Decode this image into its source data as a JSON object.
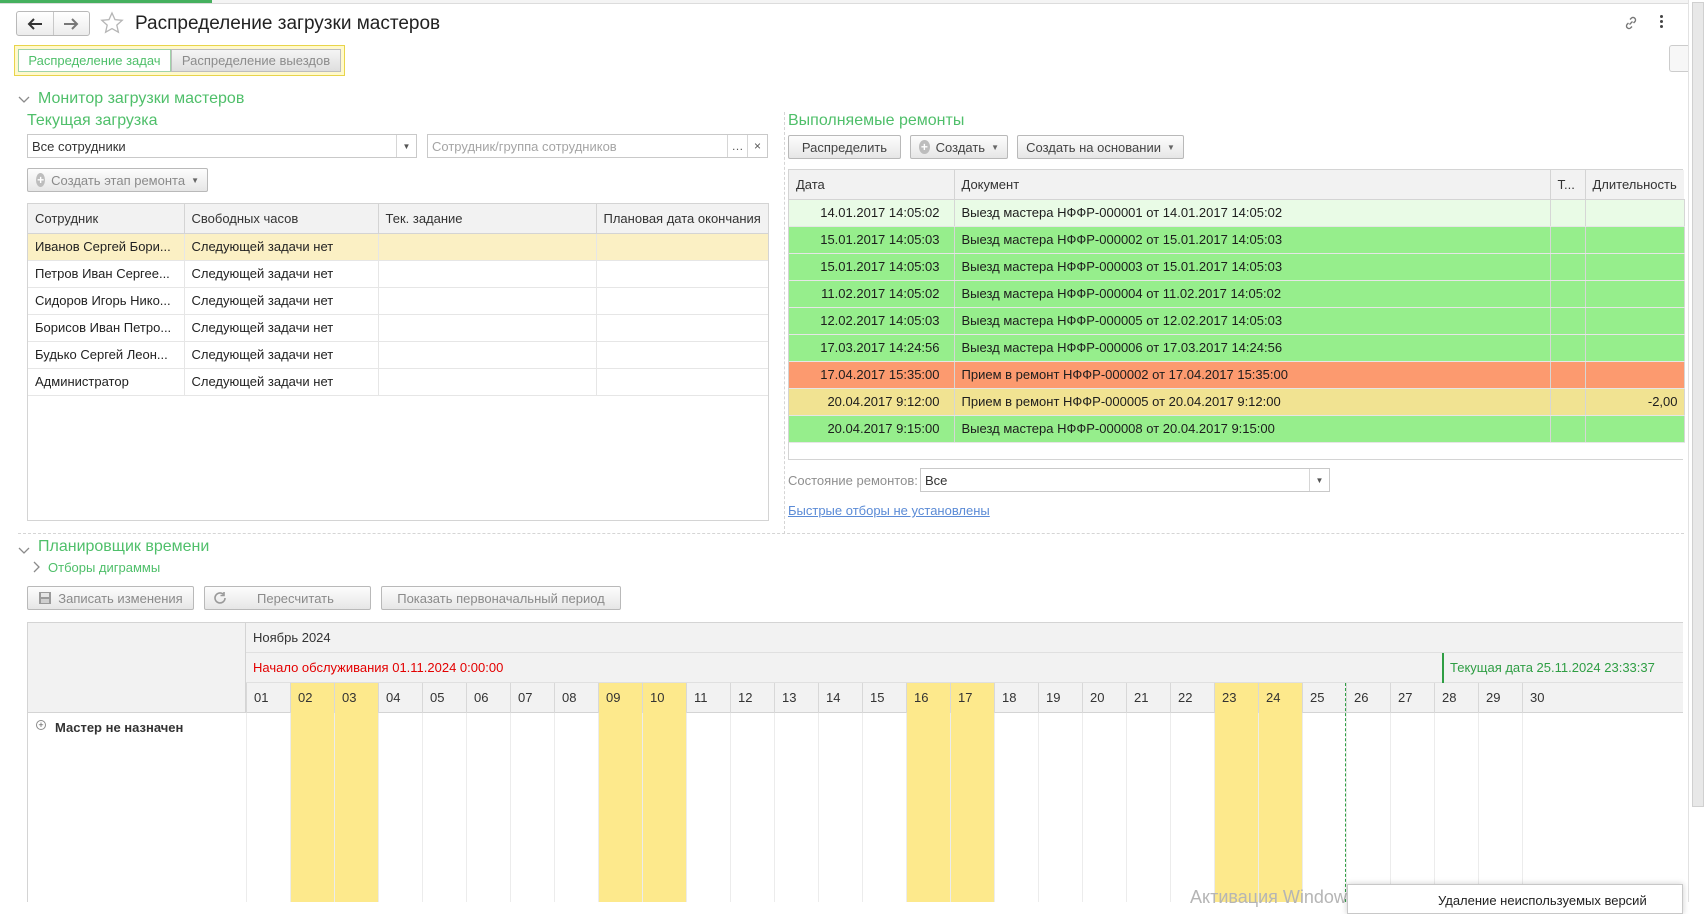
{
  "window": {
    "title": "Распределение загрузки мастеров",
    "tabs": [
      "Распределение задач",
      "Распределение выездов"
    ],
    "active_tab": 0,
    "colors": {
      "accent_green": "#4fbf6a",
      "row_green": "#96ee8c",
      "row_light_green": "#e9fbe6",
      "row_red": "#fc9a6f",
      "row_yellow": "#f1e392",
      "weekend_yellow": "#fde98c",
      "selected_row": "#fbf0c4",
      "start_red": "#e30000"
    }
  },
  "monitor": {
    "section_title": "Монитор загрузки мастеров",
    "current_load": {
      "title": "Текущая загрузка",
      "employee_filter_value": "Все сотрудники",
      "group_filter_placeholder": "Сотрудник/группа сотрудников",
      "create_stage_button": "Создать этап ремонта",
      "columns": [
        "Сотрудник",
        "Свободных часов",
        "Тек. задание",
        "Плановая дата окончания"
      ],
      "rows": [
        {
          "employee": "Иванов Сергей Бори...",
          "free_hours": "Следующей задачи нет",
          "task": "",
          "planned_end": ""
        },
        {
          "employee": "Петров Иван Сергее...",
          "free_hours": "Следующей задачи нет",
          "task": "",
          "planned_end": ""
        },
        {
          "employee": "Сидоров Игорь Нико...",
          "free_hours": "Следующей задачи нет",
          "task": "",
          "planned_end": ""
        },
        {
          "employee": "Борисов Иван Петро...",
          "free_hours": "Следующей задачи нет",
          "task": "",
          "planned_end": ""
        },
        {
          "employee": "Будько Сергей Леон...",
          "free_hours": "Следующей задачи нет",
          "task": "",
          "planned_end": ""
        },
        {
          "employee": "Администратор",
          "free_hours": "Следующей задачи нет",
          "task": "",
          "planned_end": ""
        }
      ]
    },
    "repairs": {
      "title": "Выполняемые ремонты",
      "buttons": {
        "distribute": "Распределить",
        "create": "Создать",
        "create_based_on": "Создать на основании"
      },
      "columns": [
        "Дата",
        "Документ",
        "Т...",
        "Длительность"
      ],
      "rows": [
        {
          "date": "14.01.2017 14:05:02",
          "document": "Выезд мастера НФФР-000001 от 14.01.2017 14:05:02",
          "t": "",
          "duration": "",
          "color": "#e9fbe6"
        },
        {
          "date": "15.01.2017 14:05:03",
          "document": "Выезд мастера НФФР-000002 от 15.01.2017 14:05:03",
          "t": "",
          "duration": "",
          "color": "#96ee8c"
        },
        {
          "date": "15.01.2017 14:05:03",
          "document": "Выезд мастера НФФР-000003 от 15.01.2017 14:05:03",
          "t": "",
          "duration": "",
          "color": "#96ee8c"
        },
        {
          "date": "11.02.2017 14:05:02",
          "document": "Выезд мастера НФФР-000004 от 11.02.2017 14:05:02",
          "t": "",
          "duration": "",
          "color": "#96ee8c"
        },
        {
          "date": "12.02.2017 14:05:03",
          "document": "Выезд мастера НФФР-000005 от 12.02.2017 14:05:03",
          "t": "",
          "duration": "",
          "color": "#96ee8c"
        },
        {
          "date": "17.03.2017 14:24:56",
          "document": "Выезд мастера НФФР-000006 от 17.03.2017 14:24:56",
          "t": "",
          "duration": "",
          "color": "#96ee8c"
        },
        {
          "date": "17.04.2017 15:35:00",
          "document": "Прием в ремонт НФФР-000002 от 17.04.2017 15:35:00",
          "t": "",
          "duration": "",
          "color": "#fc9a6f"
        },
        {
          "date": "20.04.2017 9:12:00",
          "document": "Прием в ремонт НФФР-000005 от 20.04.2017 9:12:00",
          "t": "",
          "duration": "-2,00",
          "color": "#f1e392"
        },
        {
          "date": "20.04.2017 9:15:00",
          "document": "Выезд мастера НФФР-000008 от 20.04.2017 9:15:00",
          "t": "",
          "duration": "",
          "color": "#96ee8c"
        }
      ],
      "state_label": "Состояние ремонтов:",
      "state_value": "Все",
      "quick_filters_link": "Быстрые отборы не установлены"
    }
  },
  "planner": {
    "section_title": "Планировщик времени",
    "filters_label": "Отборы диграммы",
    "buttons": {
      "save": "Записать изменения",
      "recalc": "Пересчитать",
      "show_period": "Показать первоначальный период"
    },
    "month": "Ноябрь 2024",
    "service_start": "Начало обслуживания 01.11.2024 0:00:00",
    "current_date": "Текущая дата 25.11.2024 23:33:37",
    "days": [
      "01",
      "02",
      "03",
      "04",
      "05",
      "06",
      "07",
      "08",
      "09",
      "10",
      "11",
      "12",
      "13",
      "14",
      "15",
      "16",
      "17",
      "18",
      "19",
      "20",
      "21",
      "22",
      "23",
      "24",
      "25",
      "26",
      "27",
      "28",
      "29",
      "30"
    ],
    "weekend_days": [
      "02",
      "03",
      "09",
      "10",
      "16",
      "17",
      "23",
      "24"
    ],
    "current_day": "25",
    "row_label": "Мастер не назначен"
  },
  "overlay": {
    "watermark": "Активация Windows",
    "notification": "Удаление неиспользуемых версий"
  }
}
